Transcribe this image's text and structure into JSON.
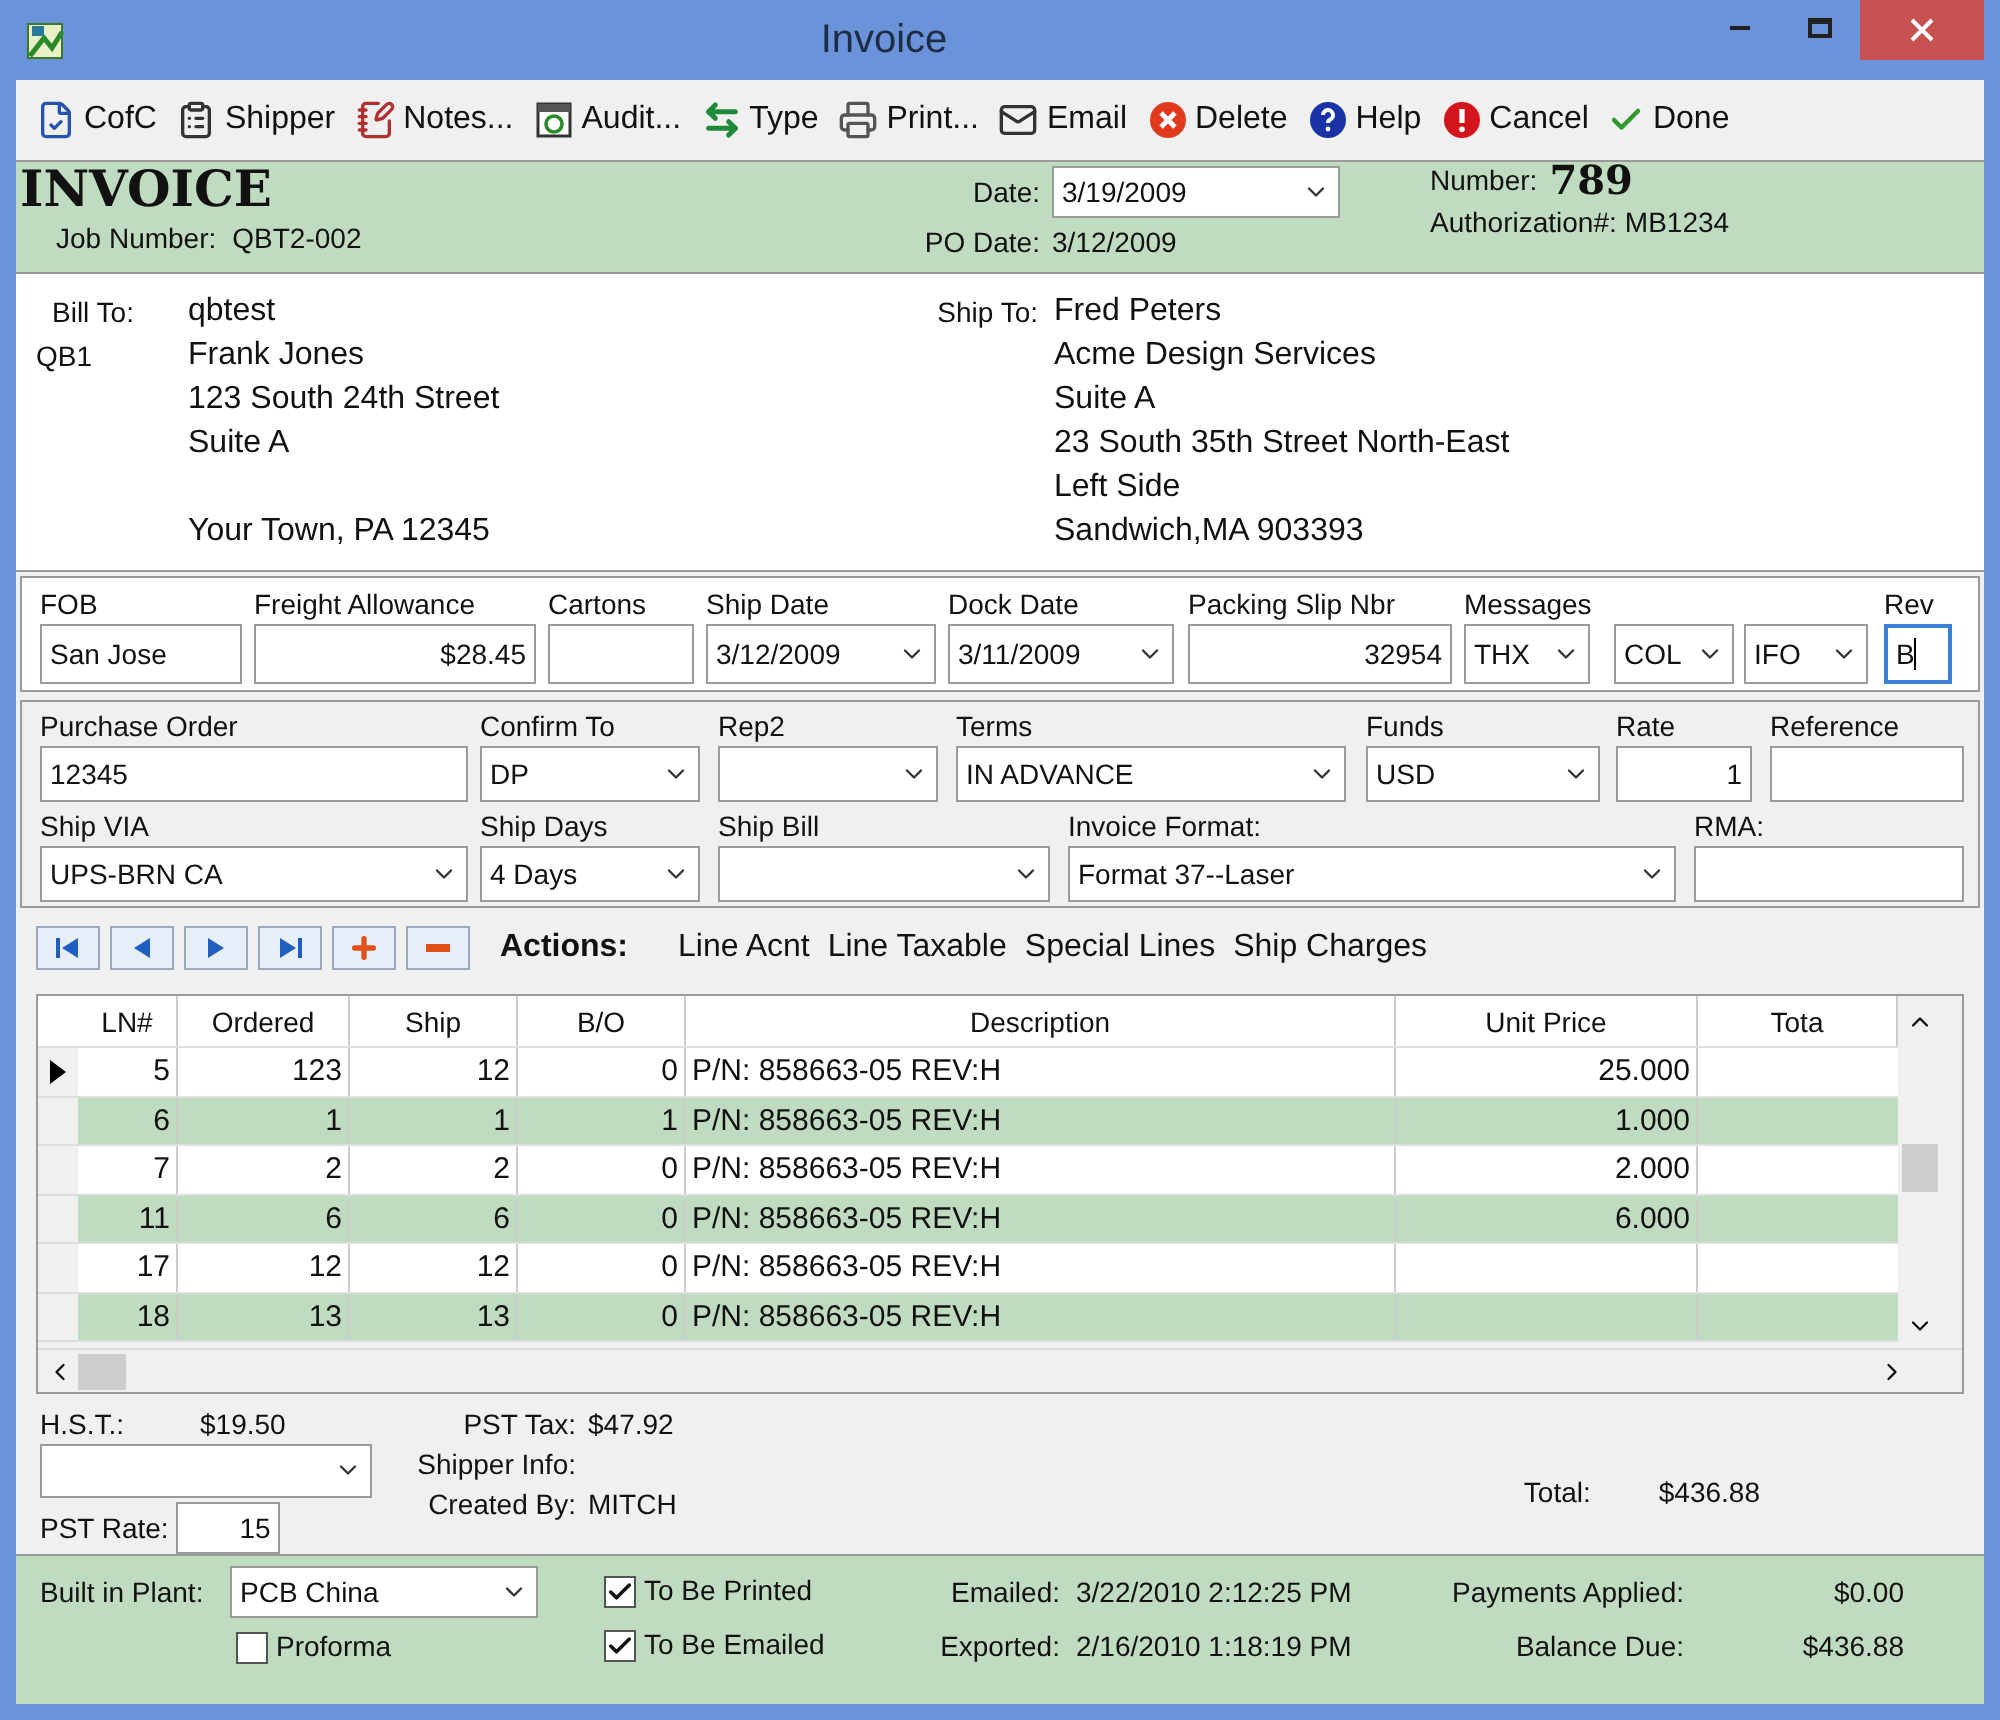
{
  "window": {
    "title": "Invoice"
  },
  "toolbar": [
    {
      "label": "CofC"
    },
    {
      "label": "Shipper"
    },
    {
      "label": "Notes..."
    },
    {
      "label": "Audit..."
    },
    {
      "label": "Type"
    },
    {
      "label": "Print..."
    },
    {
      "label": "Email"
    },
    {
      "label": "Delete"
    },
    {
      "label": "Help"
    },
    {
      "label": "Cancel"
    },
    {
      "label": "Done"
    }
  ],
  "header": {
    "title": "INVOICE",
    "job_number_label": "Job Number:",
    "job_number": "QBT2-002",
    "date_label": "Date:",
    "date": "3/19/2009",
    "po_date_label": "PO Date:",
    "po_date": "3/12/2009",
    "number_label": "Number:",
    "number": "789",
    "authorization_label": "Authorization#:",
    "authorization": "MB1234"
  },
  "bill_to": {
    "label": "Bill To:",
    "code": "QB1",
    "address_lines": [
      "qbtest",
      "Frank Jones",
      "123 South 24th Street",
      "Suite A"
    ],
    "city_line": "Your Town, PA 12345"
  },
  "ship_to": {
    "label": "Ship To:",
    "address_lines": [
      "Fred Peters",
      "Acme Design Services",
      "Suite A",
      "23 South 35th Street North-East",
      "Left Side",
      "Sandwich,MA 903393"
    ]
  },
  "shipping_fields": [
    {
      "label": "FOB",
      "value": "San Jose",
      "kind": "text",
      "focused": false
    },
    {
      "label": "Freight Allowance",
      "value": "$28.45",
      "kind": "number",
      "focused": false
    },
    {
      "label": "Cartons",
      "kind": "text",
      "focused": false
    },
    {
      "label": "Ship Date",
      "value": "3/12/2009",
      "kind": "dropdown",
      "focused": false
    },
    {
      "label": "Dock Date",
      "value": "3/11/2009",
      "kind": "dropdown",
      "focused": false
    },
    {
      "label": "Packing Slip Nbr",
      "value": "32954",
      "kind": "number",
      "focused": false
    },
    {
      "label": "Messages",
      "value": "THX",
      "kind": "dropdown",
      "focused": false
    },
    {
      "value": "COL",
      "kind": "dropdown",
      "focused": false
    },
    {
      "value": "IFO",
      "kind": "dropdown",
      "focused": false
    },
    {
      "label": "Rev",
      "value": "B",
      "kind": "text",
      "focused": true
    }
  ],
  "order_fields": [
    {
      "label": "Purchase Order",
      "value": "12345",
      "kind": "text"
    },
    {
      "label": "Confirm To",
      "value": "DP",
      "kind": "dropdown"
    },
    {
      "label": "Rep2",
      "kind": "dropdown"
    },
    {
      "label": "Terms",
      "value": "IN ADVANCE",
      "kind": "dropdown"
    },
    {
      "label": "Funds",
      "value": "USD",
      "kind": "dropdown"
    },
    {
      "label": "Rate",
      "value": "1",
      "kind": "number"
    },
    {
      "label": "Reference",
      "kind": "text"
    }
  ],
  "billing_fields": [
    {
      "label": "Ship VIA",
      "value": "UPS-BRN CA",
      "kind": "dropdown"
    },
    {
      "label": "Ship Days",
      "value": "4 Days",
      "kind": "dropdown"
    },
    {
      "label": "Ship Bill",
      "kind": "dropdown"
    },
    {
      "label": "Invoice Format:",
      "value": "Format 37--Laser",
      "kind": "dropdown"
    },
    {
      "label": "RMA:",
      "kind": "text"
    }
  ],
  "actions": {
    "label": "Actions:",
    "links": [
      "Line Acnt",
      "Line Taxable",
      "Special Lines",
      "Ship Charges"
    ]
  },
  "table": {
    "columns": [
      "LN#",
      "Ordered",
      "Ship",
      "B/O",
      "Description",
      "Unit Price",
      "Tota"
    ],
    "rows": [
      {
        "ln": "5",
        "ordered": "123",
        "ship": "12",
        "bo": "0",
        "description": "P/N: 858663-05 REV:H",
        "unit_price": "25.000",
        "current": true
      },
      {
        "ln": "6",
        "ordered": "1",
        "ship": "1",
        "bo": "1",
        "description": "P/N: 858663-05 REV:H",
        "unit_price": "1.000",
        "current": false
      },
      {
        "ln": "7",
        "ordered": "2",
        "ship": "2",
        "bo": "0",
        "description": "P/N: 858663-05 REV:H",
        "unit_price": "2.000",
        "current": false
      },
      {
        "ln": "11",
        "ordered": "6",
        "ship": "6",
        "bo": "0",
        "description": "P/N: 858663-05 REV:H",
        "unit_price": "6.000",
        "current": false
      },
      {
        "ln": "17",
        "ordered": "12",
        "ship": "12",
        "bo": "0",
        "description": "P/N: 858663-05 REV:H",
        "current": false
      },
      {
        "ln": "18",
        "ordered": "13",
        "ship": "13",
        "bo": "0",
        "description": "P/N: 858663-05 REV:H",
        "current": false
      }
    ]
  },
  "totals": {
    "hst_label": "H.S.T.:",
    "hst": "$19.50",
    "pst_tax_label": "PST Tax:",
    "pst_tax": "$47.92",
    "shipper_info_label": "Shipper Info:",
    "created_by_label": "Created By:",
    "created_by": "MITCH",
    "pst_rate_label": "PST Rate:",
    "pst_rate": "15",
    "total_label": "Total:",
    "total": "$436.88"
  },
  "footer": {
    "plant_label": "Built in Plant:",
    "plant": "PCB China",
    "checkboxes": [
      {
        "label": "Proforma",
        "checked": false
      },
      {
        "label": "To Be Printed",
        "checked": true
      },
      {
        "label": "To Be Emailed",
        "checked": true
      }
    ],
    "emailed_label": "Emailed:",
    "emailed": "3/22/2010 2:12:25 PM",
    "exported_label": "Exported:",
    "exported": "2/16/2010 1:18:19 PM",
    "payments_label": "Payments Applied:",
    "payments": "$0.00",
    "balance_label": "Balance Due:",
    "balance": "$436.88"
  }
}
